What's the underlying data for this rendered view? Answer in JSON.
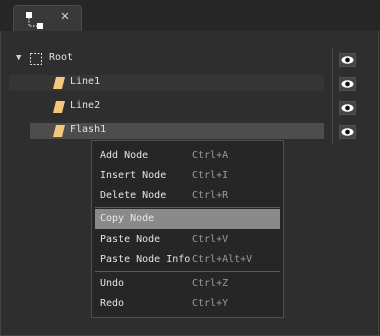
{
  "tab": {
    "icon": "node-graph-icon",
    "close": "✕"
  },
  "tree": {
    "root": {
      "label": "Root",
      "expander": "▼",
      "icon": "empty-node-icon"
    },
    "children": [
      {
        "label": "Line1",
        "icon": "layer-icon"
      },
      {
        "label": "Line2",
        "icon": "layer-icon"
      },
      {
        "label": "Flash1",
        "icon": "layer-icon"
      }
    ],
    "visibility_icon": "eye-icon"
  },
  "context_menu": {
    "items": [
      {
        "label": "Add Node",
        "shortcut": "Ctrl+A"
      },
      {
        "label": "Insert Node",
        "shortcut": "Ctrl+I"
      },
      {
        "label": "Delete Node",
        "shortcut": "Ctrl+R"
      },
      {
        "label": "Copy Node",
        "shortcut": ""
      },
      {
        "label": "Paste Node",
        "shortcut": "Ctrl+V"
      },
      {
        "label": "Paste Node Info",
        "shortcut": "Ctrl+Alt+V"
      },
      {
        "label": "Undo",
        "shortcut": "Ctrl+Z"
      },
      {
        "label": "Redo",
        "shortcut": "Ctrl+Y"
      }
    ]
  },
  "colors": {
    "node_icon_fill": "#f5c77e",
    "highlight": "#8a8a8a",
    "background": "#2e2e2e"
  }
}
